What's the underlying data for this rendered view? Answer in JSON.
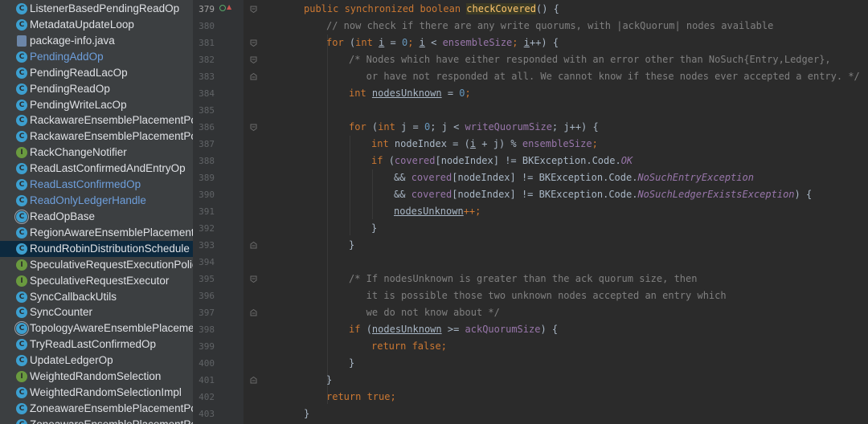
{
  "tree": {
    "items": [
      {
        "label": "ListenerBasedPendingReadOp",
        "icon": "class-icon",
        "kind": "class",
        "color": "normal"
      },
      {
        "label": "MetadataUpdateLoop",
        "icon": "class-icon",
        "kind": "class",
        "color": "normal"
      },
      {
        "label": "package-info.java",
        "icon": "java-file-icon",
        "kind": "file",
        "color": "normal"
      },
      {
        "label": "PendingAddOp",
        "icon": "class-icon",
        "kind": "class",
        "color": "blue"
      },
      {
        "label": "PendingReadLacOp",
        "icon": "class-icon",
        "kind": "class",
        "color": "normal"
      },
      {
        "label": "PendingReadOp",
        "icon": "class-icon",
        "kind": "class",
        "color": "normal"
      },
      {
        "label": "PendingWriteLacOp",
        "icon": "class-icon",
        "kind": "class",
        "color": "normal"
      },
      {
        "label": "RackawareEnsemblePlacementPo",
        "icon": "class-icon",
        "kind": "class",
        "color": "normal"
      },
      {
        "label": "RackawareEnsemblePlacementPo",
        "icon": "class-icon",
        "kind": "class",
        "color": "normal"
      },
      {
        "label": "RackChangeNotifier",
        "icon": "interface-icon",
        "kind": "interface",
        "color": "normal"
      },
      {
        "label": "ReadLastConfirmedAndEntryOp",
        "icon": "class-icon",
        "kind": "class",
        "color": "normal"
      },
      {
        "label": "ReadLastConfirmedOp",
        "icon": "class-icon",
        "kind": "class",
        "color": "blue"
      },
      {
        "label": "ReadOnlyLedgerHandle",
        "icon": "class-icon",
        "kind": "class",
        "color": "blue"
      },
      {
        "label": "ReadOpBase",
        "icon": "abstract-class-icon",
        "kind": "abstract",
        "color": "normal"
      },
      {
        "label": "RegionAwareEnsemblePlacementI",
        "icon": "class-icon",
        "kind": "class",
        "color": "normal"
      },
      {
        "label": "RoundRobinDistributionSchedule",
        "icon": "class-icon",
        "kind": "class",
        "color": "normal",
        "selected": true
      },
      {
        "label": "SpeculativeRequestExecutionPolic",
        "icon": "interface-icon",
        "kind": "interface",
        "color": "normal"
      },
      {
        "label": "SpeculativeRequestExecutor",
        "icon": "interface-icon",
        "kind": "interface",
        "color": "normal"
      },
      {
        "label": "SyncCallbackUtils",
        "icon": "class-icon",
        "kind": "class",
        "color": "normal"
      },
      {
        "label": "SyncCounter",
        "icon": "class-icon",
        "kind": "class",
        "color": "normal"
      },
      {
        "label": "TopologyAwareEnsemblePlaceme",
        "icon": "abstract-class-icon",
        "kind": "abstract",
        "color": "normal"
      },
      {
        "label": "TryReadLastConfirmedOp",
        "icon": "class-icon",
        "kind": "class",
        "color": "normal"
      },
      {
        "label": "UpdateLedgerOp",
        "icon": "class-icon",
        "kind": "class",
        "color": "normal"
      },
      {
        "label": "WeightedRandomSelection",
        "icon": "interface-icon",
        "kind": "interface",
        "color": "normal"
      },
      {
        "label": "WeightedRandomSelectionImpl",
        "icon": "class-icon",
        "kind": "class",
        "color": "normal"
      },
      {
        "label": "ZoneawareEnsemblePlacementPo",
        "icon": "class-icon",
        "kind": "class",
        "color": "normal"
      },
      {
        "label": "ZoneawareEnsemblePlacementPo",
        "icon": "class-icon",
        "kind": "class",
        "color": "normal"
      }
    ]
  },
  "editor": {
    "line_numbers": [
      "379",
      "380",
      "381",
      "382",
      "383",
      "384",
      "385",
      "386",
      "387",
      "388",
      "389",
      "390",
      "391",
      "392",
      "393",
      "394",
      "395",
      "396",
      "397",
      "398",
      "399",
      "400",
      "401",
      "402",
      "403"
    ],
    "code": {
      "l379": {
        "t1": "public synchronized boolean ",
        "t2": "checkCovered",
        "t3": "() {"
      },
      "l380": {
        "t1": "// now check if there are any write quorums, with |ackQuorum| nodes available"
      },
      "l381": {
        "t1": "for ",
        "t2": "(",
        "t3": "int ",
        "t4": "i",
        "t5": " = ",
        "t6": "0",
        "t7": "; ",
        "t8": "i",
        "t9": " < ",
        "t10": "ensembleSize",
        "t11": "; ",
        "t12": "i",
        "t13": "++) {"
      },
      "l382": {
        "t1": "/* Nodes which have either responded with an error other than NoSuch{Entry,Ledger},"
      },
      "l383": {
        "t1": "   or have not responded at all. We cannot know if these nodes ever accepted a entry. */"
      },
      "l384": {
        "t1": "int ",
        "t2": "nodesUnknown",
        "t3": " = ",
        "t4": "0",
        "t5": ";"
      },
      "l386": {
        "t1": "for ",
        "t2": "(",
        "t3": "int ",
        "t4": "j = ",
        "t5": "0",
        "t6": "; j < ",
        "t7": "writeQuorumSize",
        "t8": "; j++) {"
      },
      "l387": {
        "t1": "int ",
        "t2": "nodeIndex = (",
        "t3": "i",
        "t4": " + j) % ",
        "t5": "ensembleSize",
        "t6": ";"
      },
      "l388": {
        "t1": "if ",
        "t2": "(",
        "t3": "covered",
        "t4": "[nodeIndex] != BKException.Code.",
        "t5": "OK"
      },
      "l389": {
        "t1": "&& ",
        "t2": "covered",
        "t3": "[nodeIndex] != BKException.Code.",
        "t4": "NoSuchEntryException"
      },
      "l390": {
        "t1": "&& ",
        "t2": "covered",
        "t3": "[nodeIndex] != BKException.Code.",
        "t4": "NoSuchLedgerExistsException",
        "t5": ") {"
      },
      "l391": {
        "t1": "nodesUnknown",
        "t2": "++;"
      },
      "l392": {
        "t1": "}"
      },
      "l393": {
        "t1": "}"
      },
      "l395": {
        "t1": "/* If nodesUnknown is greater than the ack quorum size, then"
      },
      "l396": {
        "t1": "   it is possible those two unknown nodes accepted an entry which"
      },
      "l397": {
        "t1": "   we do not know about */"
      },
      "l398": {
        "t1": "if ",
        "t2": "(",
        "t3": "nodesUnknown",
        "t4": " >= ",
        "t5": "ackQuorumSize",
        "t6": ") {"
      },
      "l399": {
        "t1": "return false",
        "t2": ";"
      },
      "l400": {
        "t1": "}"
      },
      "l401": {
        "t1": "}"
      },
      "l402": {
        "t1": "return true",
        "t2": ";"
      },
      "l403": {
        "t1": "}"
      }
    }
  },
  "colors": {
    "tree_bg": "#3c3f41",
    "editor_bg": "#2b2b2b",
    "gutter_bg": "#313335",
    "keyword": "#cc7832",
    "comment": "#808080",
    "number": "#6897bb",
    "field": "#9876aa",
    "method_decl": "#ffc66d",
    "text": "#a9b7c6",
    "selected_row": "#0d293e",
    "class_icon": "#3d9fcf",
    "interface_icon": "#6a9a3f"
  }
}
